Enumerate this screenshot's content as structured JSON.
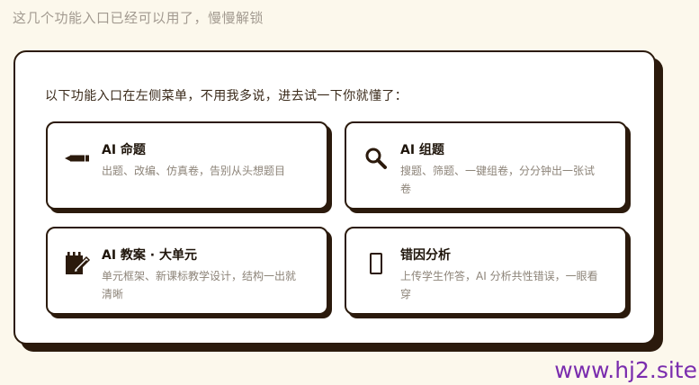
{
  "top_note": "这几个功能入口已经可以用了，慢慢解锁",
  "intro": "以下功能入口在左侧菜单，不用我多说，进去试一下你就懂了：",
  "cards": [
    {
      "icon": "pencil-icon",
      "title": "AI 命题",
      "desc": "出题、改编、仿真卷，告别从头想题目"
    },
    {
      "icon": "magnifier-icon",
      "title": "AI 组题",
      "desc": "搜题、筛题、一键组卷，分分钟出一张试卷"
    },
    {
      "icon": "edit-notebook-icon",
      "title": "AI 教案 · 大单元",
      "desc": "单元框架、新课标教学设计，结构一出就清晰"
    },
    {
      "icon": "phone-icon",
      "title": "错因分析",
      "desc": "上传学生作答，AI 分析共性错误，一眼看穿"
    }
  ],
  "watermark": "www.hj2.site",
  "colors": {
    "background": "#fcf8ec",
    "border": "#2b1a0c",
    "muted_text": "#8d8479",
    "watermark": "#7a2dae"
  }
}
